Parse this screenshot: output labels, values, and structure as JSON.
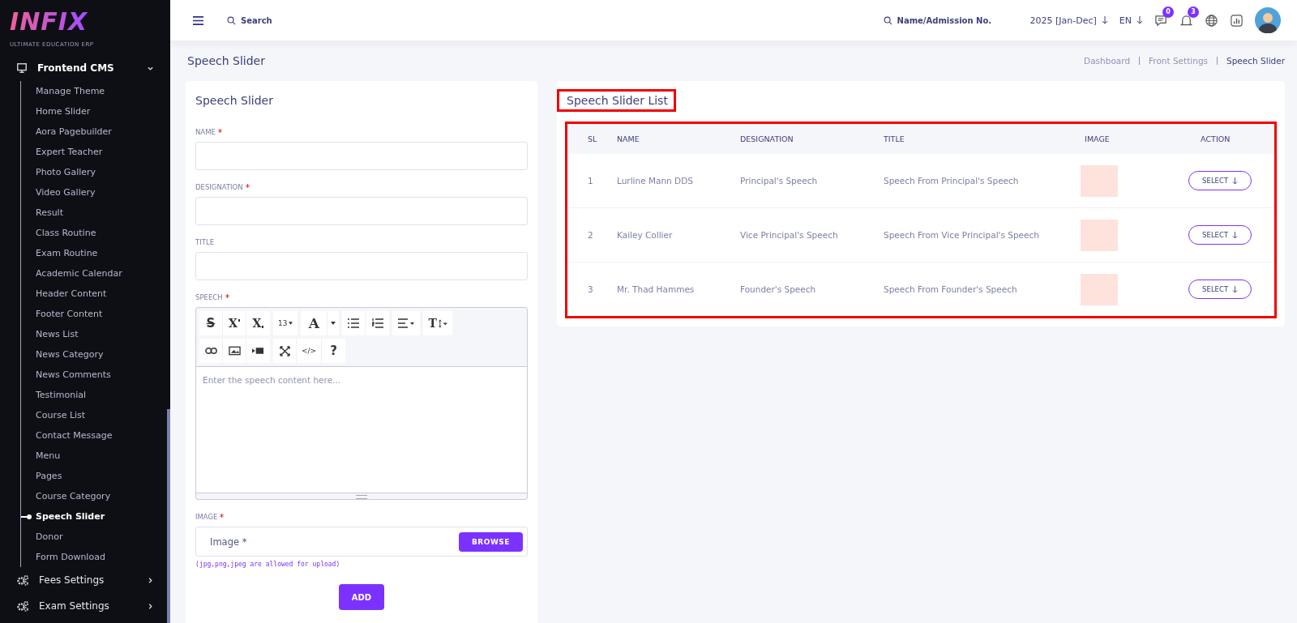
{
  "sidebar": {
    "logo": {
      "title": "INFIX",
      "subtitle": "ULTIMATE EDUCATION ERP"
    },
    "sections": [
      {
        "label": "Frontend CMS",
        "expanded": true,
        "children": [
          {
            "label": "Manage Theme",
            "selected": false
          },
          {
            "label": "Home Slider",
            "selected": false
          },
          {
            "label": "Aora Pagebuilder",
            "selected": false
          },
          {
            "label": "Expert Teacher",
            "selected": false
          },
          {
            "label": "Photo Gallery",
            "selected": false
          },
          {
            "label": "Video Gallery",
            "selected": false
          },
          {
            "label": "Result",
            "selected": false
          },
          {
            "label": "Class Routine",
            "selected": false
          },
          {
            "label": "Exam Routine",
            "selected": false
          },
          {
            "label": "Academic Calendar",
            "selected": false
          },
          {
            "label": "Header Content",
            "selected": false
          },
          {
            "label": "Footer Content",
            "selected": false
          },
          {
            "label": "News List",
            "selected": false
          },
          {
            "label": "News Category",
            "selected": false
          },
          {
            "label": "News Comments",
            "selected": false
          },
          {
            "label": "Testimonial",
            "selected": false
          },
          {
            "label": "Course List",
            "selected": false
          },
          {
            "label": "Contact Message",
            "selected": false
          },
          {
            "label": "Menu",
            "selected": false
          },
          {
            "label": "Pages",
            "selected": false
          },
          {
            "label": "Course Category",
            "selected": false
          },
          {
            "label": "Speech Slider",
            "selected": true
          },
          {
            "label": "Donor",
            "selected": false
          },
          {
            "label": "Form Download",
            "selected": false
          }
        ]
      },
      {
        "label": "Fees Settings",
        "expanded": false
      },
      {
        "label": "Exam Settings",
        "expanded": false
      }
    ]
  },
  "topbar": {
    "search": {
      "placeholder": "Search"
    },
    "student_search": {
      "placeholder": "Name/Admission No."
    },
    "session": "2025 [Jan-Dec]",
    "language": "EN",
    "message_count": "0",
    "notification_count": "3"
  },
  "page_title": "Speech Slider",
  "breadcrumb": [
    {
      "label": "Dashboard",
      "selected": false
    },
    {
      "label": "Front Settings",
      "selected": false
    },
    {
      "label": "Speech Slider",
      "selected": true
    }
  ],
  "form": {
    "title": "Speech Slider",
    "fields": [
      {
        "label": "NAME",
        "required": true
      },
      {
        "label": "DESIGNATION",
        "required": true
      },
      {
        "label": "TITLE",
        "required": false
      }
    ],
    "speech": {
      "label": "SPEECH",
      "required": true,
      "placeholder": "Enter the speech content here...",
      "toolbar": [
        [
          {
            "kind": "strike",
            "label": "S"
          },
          {
            "kind": "sup",
            "label": "X"
          },
          {
            "kind": "sub",
            "label": "X"
          }
        ],
        [
          {
            "kind": "size",
            "label": "13"
          }
        ],
        [
          {
            "kind": "color",
            "label": "A"
          },
          {
            "kind": "caret"
          }
        ],
        [
          {
            "kind": "ul"
          },
          {
            "kind": "ol"
          }
        ],
        [
          {
            "kind": "align"
          }
        ],
        [
          {
            "kind": "height",
            "label": "T"
          }
        ],
        [
          {
            "kind": "link"
          },
          {
            "kind": "picture"
          },
          {
            "kind": "video"
          }
        ],
        [
          {
            "kind": "fullscreen"
          },
          {
            "kind": "code",
            "label": "</>"
          },
          {
            "kind": "help",
            "label": "?"
          }
        ]
      ]
    },
    "image": {
      "label": "IMAGE",
      "required": true,
      "placeholder": "Image *",
      "button": "BROWSE",
      "hint": "(jpg,png,jpeg are allowed for upload)"
    },
    "submit": "ADD"
  },
  "list": {
    "title": "Speech Slider List",
    "highlighted": true,
    "table_highlighted": true,
    "columns": [
      "SL",
      "NAME",
      "DESIGNATION",
      "TITLE",
      "IMAGE",
      "ACTION"
    ],
    "rows": [
      {
        "sl": "1",
        "name": "Lurline Mann DDS",
        "designation": "Principal's Speech",
        "title": "Speech From Principal's Speech",
        "action": "SELECT"
      },
      {
        "sl": "2",
        "name": "Kailey Collier",
        "designation": "Vice Principal's Speech",
        "title": "Speech From Vice Principal's Speech",
        "action": "SELECT"
      },
      {
        "sl": "3",
        "name": "Mr. Thad Hammes",
        "designation": "Founder's Speech",
        "title": "Speech From Founder's Speech",
        "action": "SELECT"
      }
    ]
  }
}
